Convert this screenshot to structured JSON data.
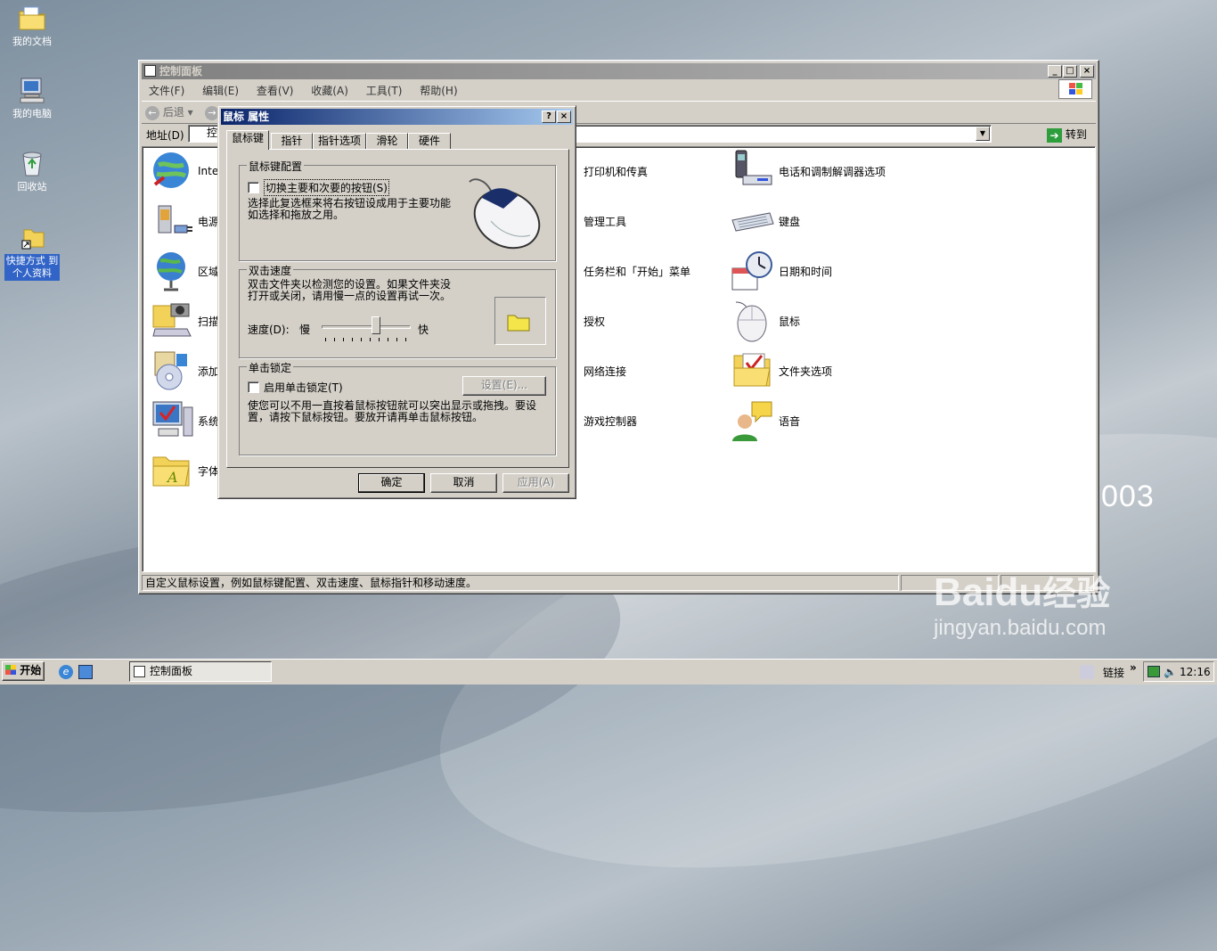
{
  "desktop": {
    "icons": [
      {
        "label": "我的文档",
        "icon": "folder-documents-icon"
      },
      {
        "label": "我的电脑",
        "icon": "computer-icon"
      },
      {
        "label": "回收站",
        "icon": "recycle-bin-icon"
      },
      {
        "label": "快捷方式 到\n个人资料",
        "icon": "folder-shortcut-icon"
      }
    ],
    "brand_fragment": "003"
  },
  "window": {
    "title": "控制面板",
    "menu": [
      "文件(F)",
      "编辑(E)",
      "查看(V)",
      "收藏(A)",
      "工具(T)",
      "帮助(H)"
    ],
    "back_label": "后退",
    "address_label": "地址(D)",
    "address_value": "控",
    "go_label": "转到",
    "items_left": [
      "Intern",
      "电源",
      "区域",
      "扫描",
      "添加",
      "系统",
      "字体"
    ],
    "items_mid": [
      "打印机和传真",
      "管理工具",
      "任务栏和「开始」菜单",
      "授权",
      "网络连接",
      "游戏控制器"
    ],
    "items_right": [
      "电话和调制解调器选项",
      "键盘",
      "日期和时间",
      "鼠标",
      "文件夹选项",
      "语音"
    ],
    "status_text": "自定义鼠标设置，例如鼠标键配置、双击速度、鼠标指针和移动速度。"
  },
  "dialog": {
    "title": "鼠标 属性",
    "tabs": [
      "鼠标键",
      "指针",
      "指针选项",
      "滑轮",
      "硬件"
    ],
    "active_tab": "鼠标键",
    "button_config": {
      "legend": "鼠标键配置",
      "checkbox_label": "切换主要和次要的按钮(S)",
      "checked": false,
      "description": "选择此复选框来将右按钮设成用于主要功能如选择和拖放之用。"
    },
    "double_click": {
      "legend": "双击速度",
      "description": "双击文件夹以检测您的设置。如果文件夹没打开或关闭，请用慢一点的设置再试一次。",
      "speed_label": "速度(D):",
      "slow_label": "慢",
      "fast_label": "快",
      "speed_level": 0.62
    },
    "click_lock": {
      "legend": "单击锁定",
      "checkbox_label": "启用单击锁定(T)",
      "checked": false,
      "settings_button": "设置(E)...",
      "description": "使您可以不用一直按着鼠标按钮就可以突出显示或拖拽。要设置，请按下鼠标按钮。要放开请再单击鼠标按钮。"
    },
    "ok": "确定",
    "cancel": "取消",
    "apply": "应用(A)"
  },
  "taskbar": {
    "start": "开始",
    "task": "控制面板",
    "links": "链接",
    "clock": "12:16"
  },
  "watermark": {
    "brand": "Bai",
    "brand_du": "du",
    "brand_jingyan": "经验",
    "url": "jingyan.baidu.com"
  },
  "colors": {
    "title_active": "#0a246a",
    "title_inactive": "#808080",
    "face": "#d4d0c8"
  }
}
